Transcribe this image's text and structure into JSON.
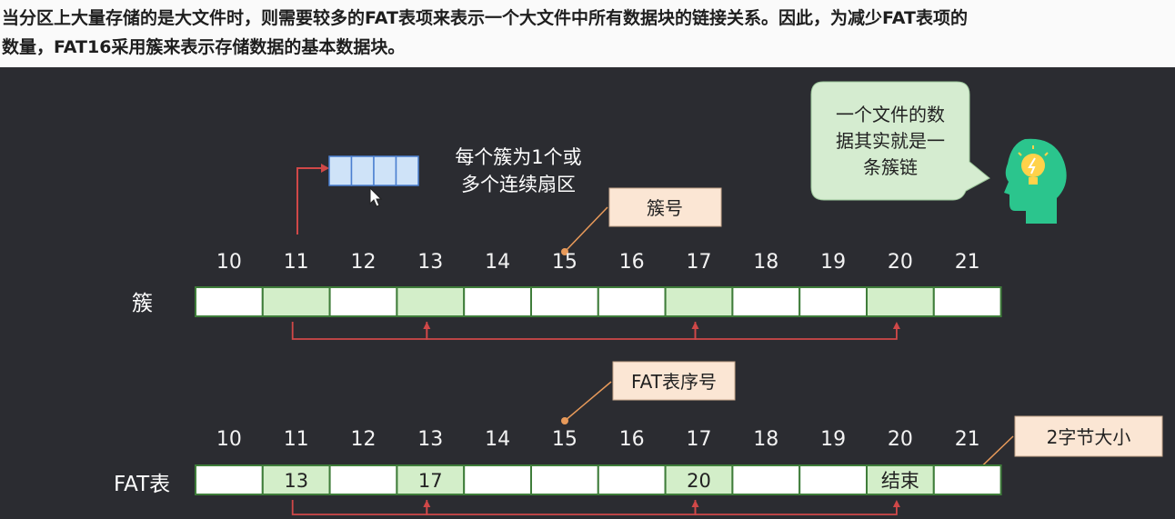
{
  "header": {
    "line1": "当分区上大量存储的是大文件时，则需要较多的FAT表项来表示一个大文件中所有数据块的链接关系。因此，为减少FAT表项的",
    "line2": "数量，FAT16采用簇来表示存储数据的基本数据块。"
  },
  "cluster_note": {
    "line1": "每个簇为1个或",
    "line2": "多个连续扇区"
  },
  "bubble": {
    "line1": "一个文件的数",
    "line2": "据其实就是一",
    "line3": "条簇链"
  },
  "callouts": {
    "cluster_number": "簇号",
    "fat_index": "FAT表序号",
    "entry_size": "2字节大小"
  },
  "rows": {
    "cluster_label": "簇",
    "fat_label": "FAT表"
  },
  "indices": [
    "10",
    "11",
    "12",
    "13",
    "14",
    "15",
    "16",
    "17",
    "18",
    "19",
    "20",
    "21"
  ],
  "cluster_highlight": [
    false,
    true,
    false,
    true,
    false,
    false,
    false,
    true,
    false,
    false,
    true,
    false
  ],
  "fat_values": [
    "",
    "13",
    "",
    "17",
    "",
    "",
    "",
    "20",
    "",
    "",
    "结束",
    ""
  ],
  "colors": {
    "background": "#2b2c31",
    "cell": "#ffffff",
    "highlight": "#d3eec9",
    "cell_border": "#3f7d3a",
    "arrow": "#d04848",
    "callout_bg": "#fbe6d4",
    "bubble_bg": "#d5ecd0",
    "sector_fill": "#cfe3f8",
    "sector_border": "#4a7fd0",
    "bulb": "#2bc58d"
  }
}
